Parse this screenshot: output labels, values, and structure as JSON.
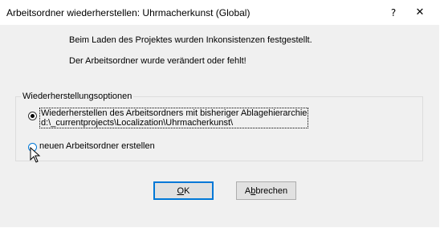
{
  "window": {
    "title": "Arbeitsordner wiederherstellen: Uhrmacherkunst (Global)"
  },
  "titlebar": {
    "help_glyph": "?",
    "close_glyph": "✕"
  },
  "messages": {
    "line1": "Beim Laden des Projektes wurden Inkonsistenzen festgestellt.",
    "line2": "Der Arbeitsordner wurde verändert oder fehlt!"
  },
  "options": {
    "legend": "Wiederherstellungsoptionen",
    "restore": {
      "line1": "Wiederherstellen des Arbeitsordners mit bisheriger Ablagehierarchie",
      "line2": "d:\\_currentprojects\\Localization\\Uhrmacherkunst\\",
      "selected": true
    },
    "new_folder": {
      "label": "neuen Arbeitsordner erstellen",
      "selected": false
    }
  },
  "buttons": {
    "ok": {
      "accel": "O",
      "rest": "K"
    },
    "cancel": {
      "pre": "A",
      "accel": "b",
      "rest": "brechen"
    }
  }
}
